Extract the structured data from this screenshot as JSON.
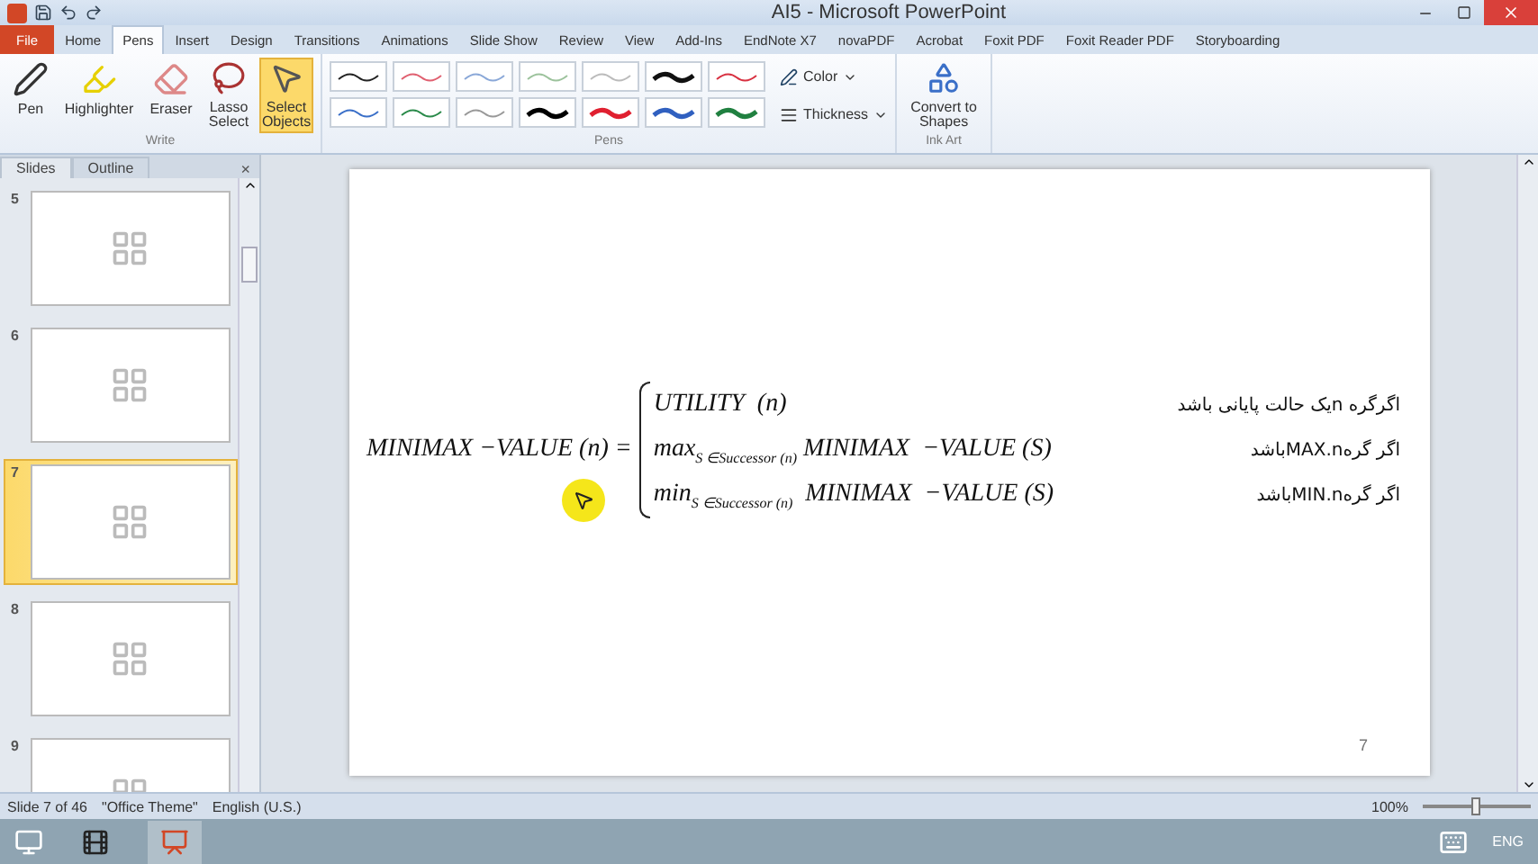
{
  "window": {
    "title": "AI5 - Microsoft PowerPoint"
  },
  "ribbon_tabs": [
    {
      "label": "File",
      "selected": false,
      "kind": "file"
    },
    {
      "label": "Home",
      "selected": false,
      "kind": "tab"
    },
    {
      "label": "Pens",
      "selected": true,
      "kind": "tab"
    },
    {
      "label": "Insert",
      "selected": false,
      "kind": "tab"
    },
    {
      "label": "Design",
      "selected": false,
      "kind": "tab"
    },
    {
      "label": "Transitions",
      "selected": false,
      "kind": "tab"
    },
    {
      "label": "Animations",
      "selected": false,
      "kind": "tab"
    },
    {
      "label": "Slide Show",
      "selected": false,
      "kind": "tab"
    },
    {
      "label": "Review",
      "selected": false,
      "kind": "tab"
    },
    {
      "label": "View",
      "selected": false,
      "kind": "tab"
    },
    {
      "label": "Add-Ins",
      "selected": false,
      "kind": "tab"
    },
    {
      "label": "EndNote X7",
      "selected": false,
      "kind": "tab"
    },
    {
      "label": "novaPDF",
      "selected": false,
      "kind": "tab"
    },
    {
      "label": "Acrobat",
      "selected": false,
      "kind": "tab"
    },
    {
      "label": "Foxit PDF",
      "selected": false,
      "kind": "tab"
    },
    {
      "label": "Foxit Reader PDF",
      "selected": false,
      "kind": "tab"
    },
    {
      "label": "Storyboarding",
      "selected": false,
      "kind": "tab"
    }
  ],
  "ribbon": {
    "write": {
      "label": "Write",
      "tools": [
        {
          "label": "Pen",
          "kind": "pen",
          "selected": false
        },
        {
          "label": "Highlighter",
          "kind": "highlighter",
          "selected": false
        },
        {
          "label": "Eraser",
          "kind": "eraser",
          "selected": false
        },
        {
          "label": "Lasso Select",
          "kind": "lasso",
          "selected": false
        },
        {
          "label": "Select Objects",
          "kind": "select",
          "selected": true
        }
      ]
    },
    "pens": {
      "label": "Pens",
      "color_button": "Color",
      "thickness_button": "Thickness",
      "swatches": [
        {
          "color": "#222222",
          "kind": "thin"
        },
        {
          "color": "#e06070",
          "kind": "thin"
        },
        {
          "color": "#8aa8d8",
          "kind": "thin"
        },
        {
          "color": "#9cc29c",
          "kind": "thin"
        },
        {
          "color": "#bbbbbb",
          "kind": "thin"
        },
        {
          "color": "#111111",
          "kind": "thick"
        },
        {
          "color": "#d83040",
          "kind": "thin"
        },
        {
          "color": "#3a6fc8",
          "kind": "thin"
        },
        {
          "color": "#2a8a4a",
          "kind": "thin"
        },
        {
          "color": "#999999",
          "kind": "thin"
        },
        {
          "color": "#000000",
          "kind": "thick"
        },
        {
          "color": "#e02030",
          "kind": "thick"
        },
        {
          "color": "#3060c0",
          "kind": "thick"
        },
        {
          "color": "#208040",
          "kind": "thick"
        }
      ]
    },
    "ink_art": {
      "label": "Ink Art",
      "convert": "Convert to Shapes"
    }
  },
  "slides_panel": {
    "tabs": [
      {
        "label": "Slides",
        "selected": true
      },
      {
        "label": "Outline",
        "selected": false
      }
    ],
    "close": "×",
    "thumbnails": [
      {
        "number": "5",
        "selected": false
      },
      {
        "number": "6",
        "selected": false
      },
      {
        "number": "7",
        "selected": true
      },
      {
        "number": "8",
        "selected": false
      },
      {
        "number": "9",
        "selected": false
      }
    ]
  },
  "slide": {
    "lhs": "MINIMAX  −VALUE (n) =",
    "cases": [
      {
        "expr": "UTILITY  (n)",
        "condition": "اگرگره nیک حالت پایانی باشد"
      },
      {
        "expr": "max$_{S ∈Successor (n)}$ MINIMAX  −VALUE (S)",
        "condition": "اگر گرهMAX.nباشد"
      },
      {
        "expr": "min$_{S ∈Successor (n)}$  MINIMAX  −VALUE (S)",
        "condition": "اگر گرهMIN.nباشد"
      }
    ],
    "page_number": "7"
  },
  "status_bar": {
    "slide": "Slide 7 of 46",
    "theme": "\"Office Theme\"",
    "language": "English (U.S.)",
    "zoom": "100%",
    "zoom_slider": {
      "level": 0.5
    }
  },
  "taskbar": {
    "language": "ENG"
  }
}
